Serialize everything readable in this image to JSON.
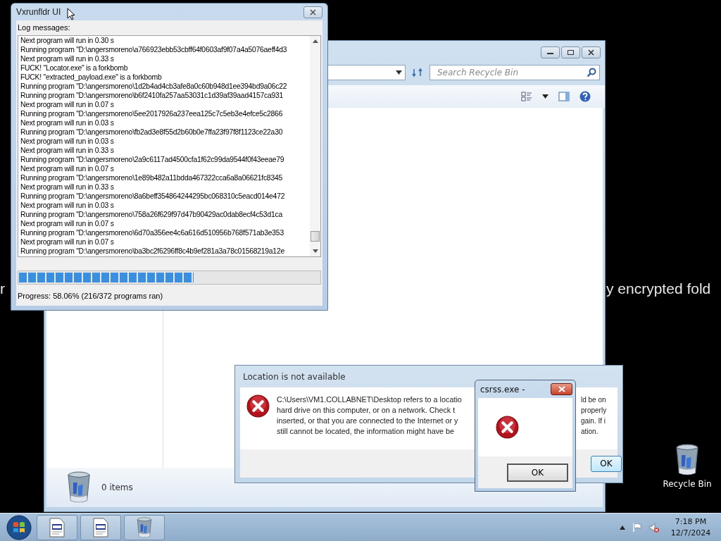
{
  "desktop": {
    "banner_left": "r",
    "banner_right": "y encrypted fold",
    "icons": [
      {
        "label": "Recycle Bin"
      }
    ]
  },
  "explorer": {
    "search": {
      "placeholder": "Search Recycle Bin"
    },
    "status": "0 items"
  },
  "log_window": {
    "title": "Vxrunfldr UI",
    "log_label": "Log messages:",
    "log": [
      "Next program will run in 0.30 s",
      "Running program \"D:\\angersmoreno\\a766923ebb53cbff64f0603af9f07a4a5076aeff4d3",
      "Next program will run in 0.33 s",
      "FUCK! \"Locator.exe\" is a forkbomb",
      "FUCK! \"extracted_payload.exe\" is a forkbomb",
      "Running program \"D:\\angersmoreno\\1d2b4ad4cb3afe8a0c60b948d1ee394bd9a06c22",
      "Running program \"D:\\angersmoreno\\b6f2410fa257aa53031c1d39af39aad4157ca931",
      "Next program will run in 0.07 s",
      "Running program \"D:\\angersmoreno\\5ee2017926a237eea125c7c5eb3e4efce5c2866",
      "Next program will run in 0.03 s",
      "Running program \"D:\\angersmoreno\\fb2ad3e8f55d2b60b0e7ffa23f97f8f1123ce22a30",
      "Next program will run in 0.03 s",
      "Next program will run in 0.33 s",
      "Running program \"D:\\angersmoreno\\2a9c6117ad4500cfa1f62c99da9544f0f43eeae79",
      "Next program will run in 0.07 s",
      "Running program \"D:\\angersmoreno\\1e89b482a11bdda467322cca6a8a06621fc8345",
      "Next program will run in 0.33 s",
      "Running program \"D:\\angersmoreno\\8a6beff354864244295bc068310c5eacd014e472",
      "Next program will run in 0.03 s",
      "Running program \"D:\\angersmoreno\\758a26f629f97d47b90429ac0dab8ecf4c53d1ca",
      "Next program will run in 0.07 s",
      "Running program \"D:\\angersmoreno\\6d70a356ee4c6a616d510956b768f571ab3e353",
      "Next program will run in 0.07 s",
      "Running program \"D:\\angersmoreno\\ba3bc2f6296ff8c4b9ef281a3a78c01568219a12e"
    ],
    "progress": {
      "level": 0.58,
      "text": "Progress: 58.06% (216/372 programs ran)"
    }
  },
  "location_dialog": {
    "title": "Location is not available",
    "message_lines": [
      {
        "left": "C:\\Users\\VM1.COLLABNET\\Desktop refers to a locatio",
        "right": "ld be on"
      },
      {
        "left": "hard drive on this computer, or on a network. Check t",
        "right": "properly"
      },
      {
        "left": "inserted, or that you are connected to the Internet or y",
        "right": "gain. If i"
      },
      {
        "left": "still cannot be located, the information might have be",
        "right": "ation."
      }
    ],
    "button": "OK"
  },
  "csrss_dialog": {
    "title": "csrss.exe -",
    "button": "OK"
  },
  "taskbar": {
    "buttons": [
      {
        "kind": "app"
      },
      {
        "kind": "app"
      },
      {
        "kind": "recycle"
      }
    ],
    "time": "7:18 PM",
    "date": "12/7/2024"
  }
}
